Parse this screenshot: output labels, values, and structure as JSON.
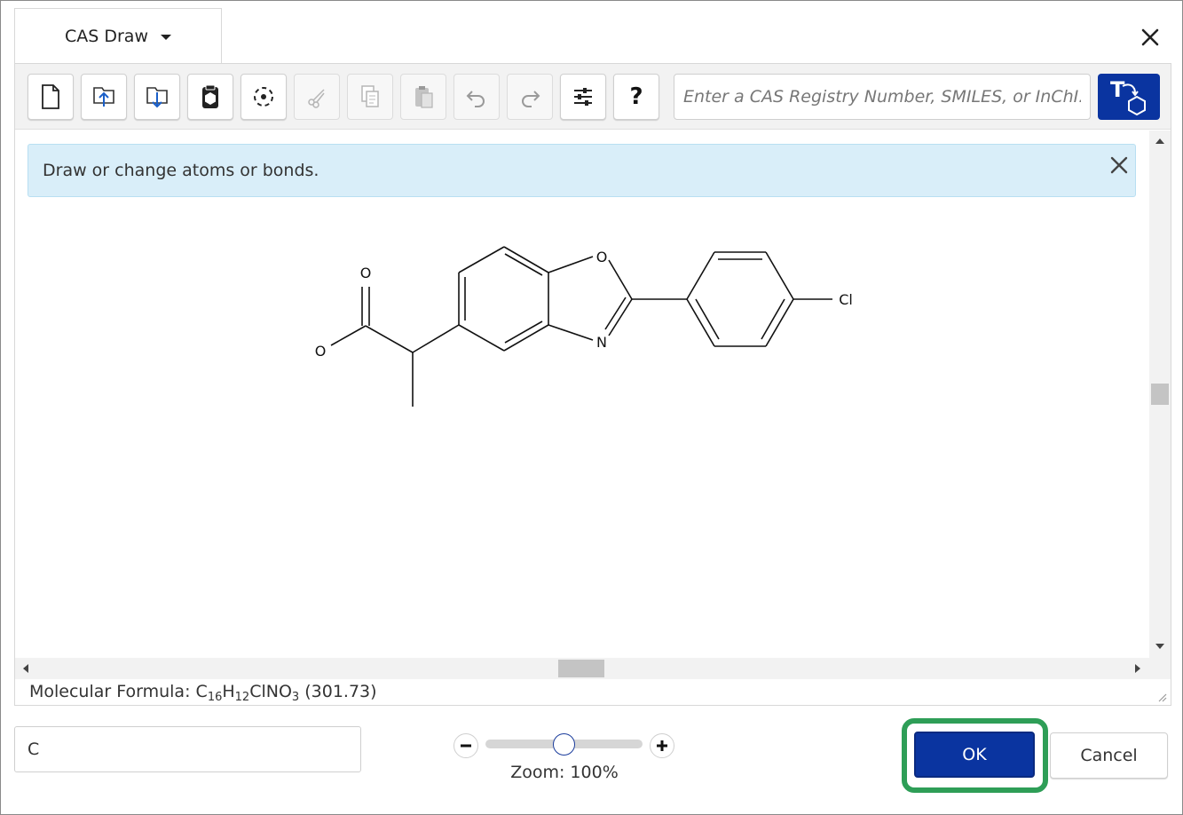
{
  "header": {
    "tab_title": "CAS Draw",
    "close_icon": "close-icon"
  },
  "toolbar": {
    "buttons": [
      {
        "name": "new-document",
        "icon": "document-icon",
        "enabled": true
      },
      {
        "name": "import",
        "icon": "import-icon",
        "enabled": true
      },
      {
        "name": "export",
        "icon": "export-icon",
        "enabled": true
      },
      {
        "name": "templates",
        "icon": "template-icon",
        "enabled": true
      },
      {
        "name": "select-all",
        "icon": "select-icon",
        "enabled": true
      },
      {
        "name": "cut",
        "icon": "scissors-icon",
        "enabled": false
      },
      {
        "name": "copy",
        "icon": "copy-icon",
        "enabled": false
      },
      {
        "name": "paste",
        "icon": "paste-icon",
        "enabled": false
      },
      {
        "name": "undo",
        "icon": "undo-icon",
        "enabled": false
      },
      {
        "name": "redo",
        "icon": "redo-icon",
        "enabled": false
      },
      {
        "name": "settings",
        "icon": "sliders-icon",
        "enabled": true
      },
      {
        "name": "help",
        "icon": "question-icon",
        "enabled": true
      }
    ],
    "help_label": "?",
    "search_placeholder": "Enter a CAS Registry Number, SMILES, or InChI...",
    "search_value": "",
    "text_to_structure_label": "T",
    "accent_color": "#0a34a0"
  },
  "info_banner": {
    "text": "Draw or change atoms or bonds.",
    "background": "#d9eef9"
  },
  "molecule": {
    "atom_labels": {
      "carbonyl_oxygen": "O",
      "hydroxyl_oxygen": "O",
      "ring_oxygen": "O",
      "ring_nitrogen": "N",
      "chlorine": "Cl"
    }
  },
  "status": {
    "formula_label": "Molecular Formula:",
    "formula_parts": [
      {
        "text": "C",
        "sub": "16"
      },
      {
        "text": "H",
        "sub": "12"
      },
      {
        "text": "ClNO",
        "sub": "3"
      }
    ],
    "mass": "(301.73)"
  },
  "bottom": {
    "atom_input_value": "C",
    "zoom_label": "Zoom: 100%",
    "zoom_percent": 100,
    "ok_label": "OK",
    "cancel_label": "Cancel",
    "highlight_color": "#2e9e57"
  }
}
